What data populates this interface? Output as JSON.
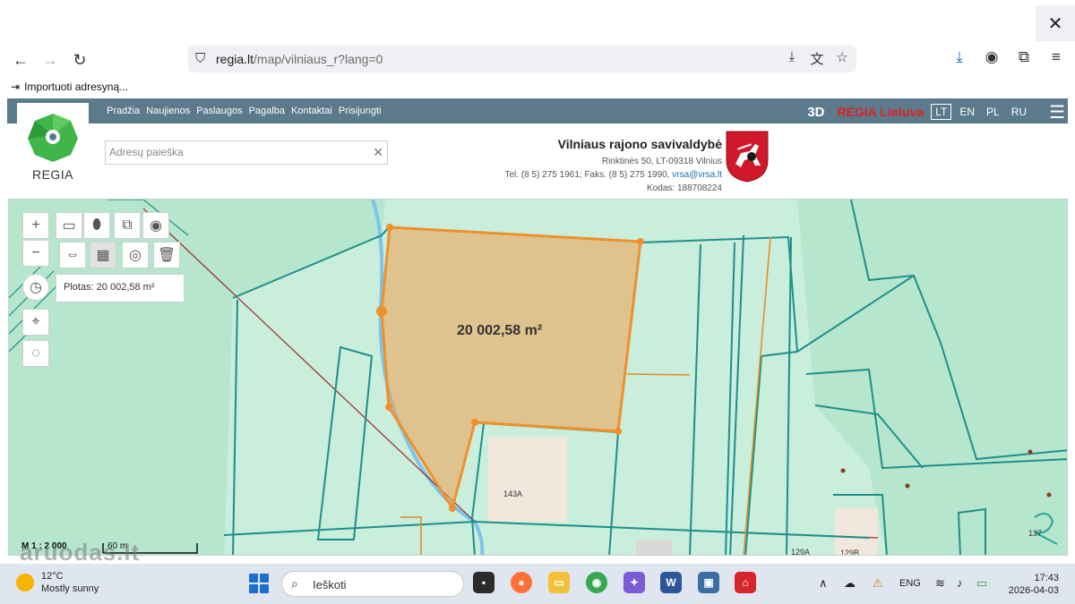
{
  "browser": {
    "url_host": "regia.lt",
    "url_path": "/map/vilniaus_r?lang=0",
    "bookmark_label": "Importuoti adresyną..."
  },
  "site": {
    "nav": [
      "Pradžia",
      "Naujienos",
      "Paslaugos",
      "Pagalba",
      "Kontaktai",
      "Prisijungti"
    ],
    "btn_3d": "3D",
    "regia_lt": "REGIA Lietuva",
    "languages": [
      "LT",
      "EN",
      "PL",
      "RU"
    ],
    "active_language": "LT",
    "logo_text": "REGIA",
    "search_placeholder": "Adresų paieška"
  },
  "municipality": {
    "name": "Vilniaus rajono savivaldybė",
    "address": "Rinktinės 50, LT-09318 Vilnius",
    "phone_fax": "Tel. (8 5) 275 1961; Faks. (8 5) 275 1990,",
    "email": "vrsa@vrsa.lt",
    "code": "Kodas: 188708224"
  },
  "map": {
    "area_panel": "Plotas: 20 002,58 m²",
    "area_label": "20 002,58 m²",
    "scale": "M 1 : 2 000",
    "scale_bar": "60 m",
    "parcel_labels": [
      "143A",
      "129A",
      "129B",
      "137"
    ]
  },
  "watermark": "aruodas.lt",
  "taskbar": {
    "temperature": "12°C",
    "weather": "Mostly sunny",
    "search_label": "Ieškoti",
    "lang": "ENG",
    "time": "17:43",
    "date": "2026-04-03"
  },
  "colors": {
    "site_bar": "#5b7a8c",
    "parcel_line": "#1f8f8a",
    "selection": "#f0902a",
    "road": "#9b2a2a",
    "map_bg": "#c9eedc"
  }
}
